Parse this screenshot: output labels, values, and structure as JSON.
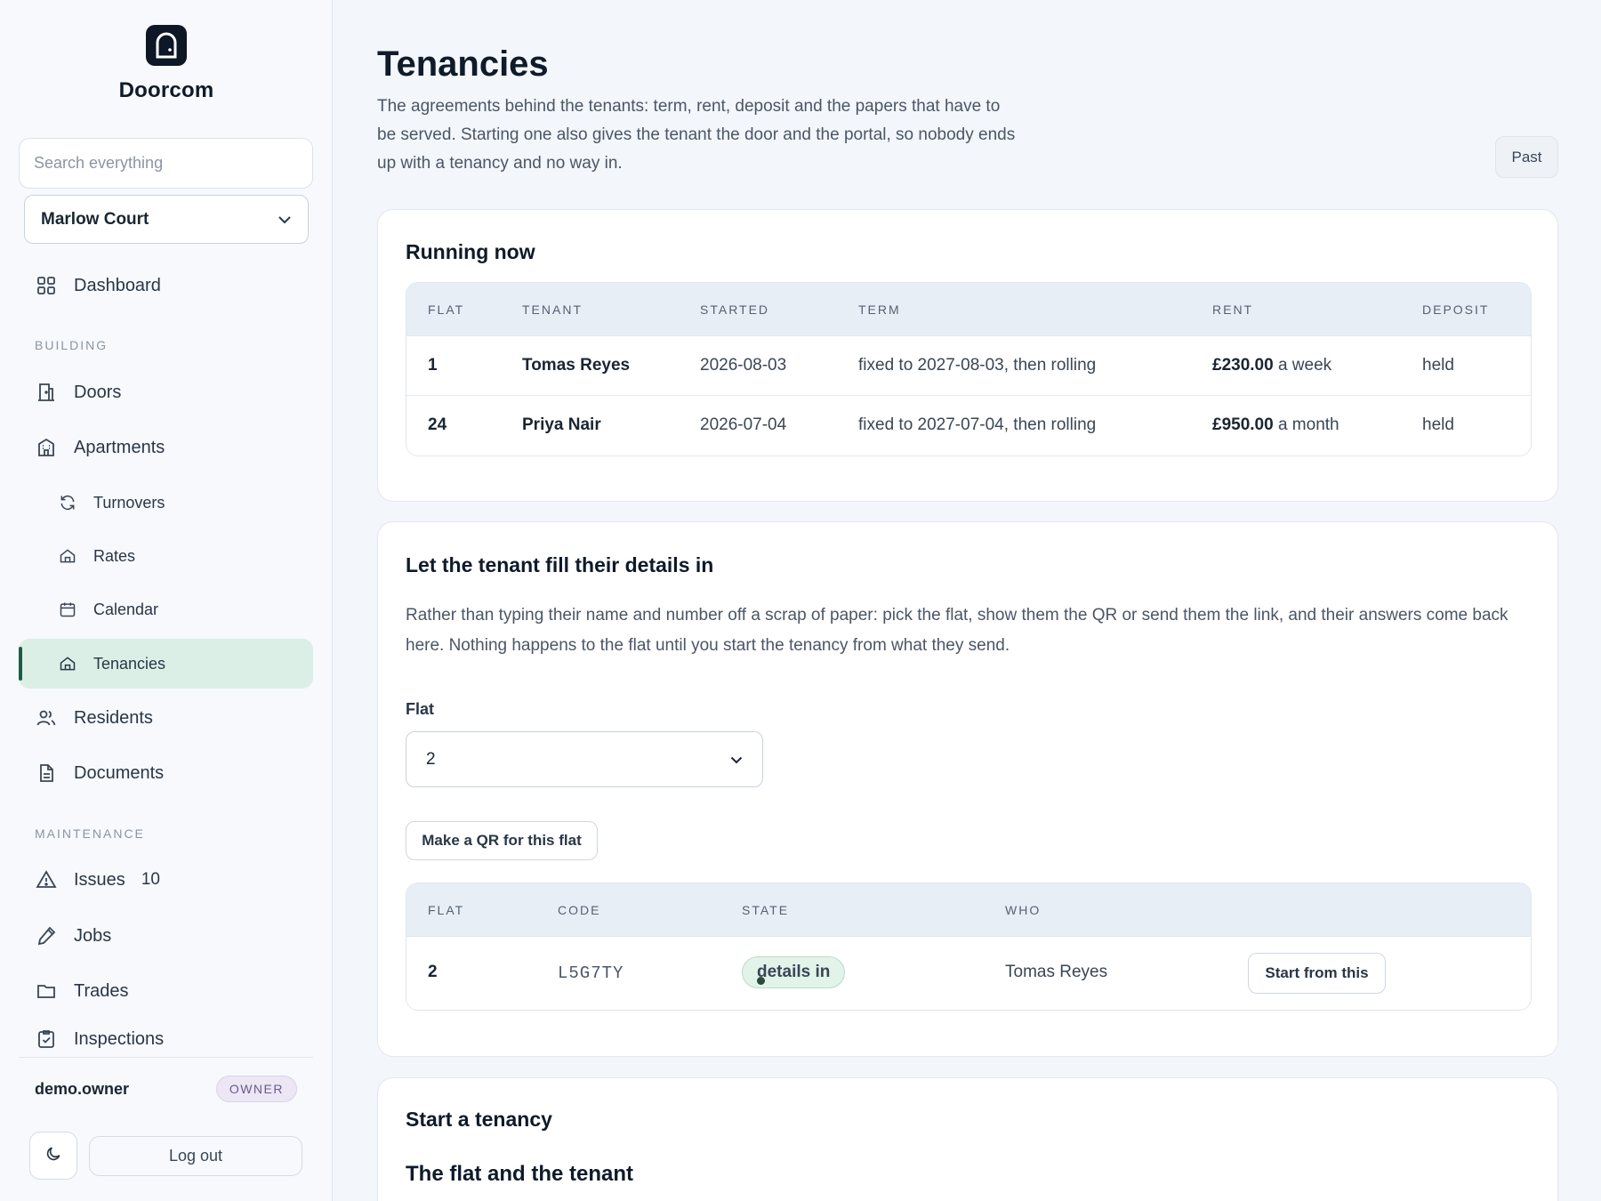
{
  "brand": {
    "name": "Doorcom"
  },
  "sidebar": {
    "search_placeholder": "Search everything",
    "building": "Marlow Court",
    "dashboard": "Dashboard",
    "section_building": "BUILDING",
    "doors": "Doors",
    "apartments": "Apartments",
    "turnovers": "Turnovers",
    "rates": "Rates",
    "calendar": "Calendar",
    "tenancies": "Tenancies",
    "residents": "Residents",
    "documents": "Documents",
    "section_maintenance": "MAINTENANCE",
    "issues": "Issues",
    "issues_count": "10",
    "jobs": "Jobs",
    "trades": "Trades",
    "inspections": "Inspections",
    "user": "demo.owner",
    "role": "OWNER",
    "logout": "Log out"
  },
  "page": {
    "title": "Tenancies",
    "description": "The agreements behind the tenants: term, rent, deposit and the papers that have to be served. Starting one also gives the tenant the door and the portal, so nobody ends up with a tenancy and no way in.",
    "past_button": "Past"
  },
  "running": {
    "title": "Running now",
    "headers": {
      "flat": "FLAT",
      "tenant": "TENANT",
      "started": "STARTED",
      "term": "TERM",
      "rent": "RENT",
      "deposit": "DEPOSIT"
    },
    "rows": [
      {
        "flat": "1",
        "tenant": "Tomas Reyes",
        "started": "2026-08-03",
        "term": "fixed to 2027-08-03, then rolling",
        "rent_amount": "£230.00",
        "rent_period": " a week",
        "deposit": "held"
      },
      {
        "flat": "24",
        "tenant": "Priya Nair",
        "started": "2026-07-04",
        "term": "fixed to 2027-07-04, then rolling",
        "rent_amount": "£950.00",
        "rent_period": " a month",
        "deposit": "held"
      }
    ]
  },
  "fill": {
    "title": "Let the tenant fill their details in",
    "lead": "Rather than typing their name and number off a scrap of paper: pick the flat, show them the QR or send them the link, and their answers come back here. Nothing happens to the flat until you start the tenancy from what they send.",
    "flat_label": "Flat",
    "flat_value": "2",
    "qr_button": "Make a QR for this flat",
    "headers": {
      "flat": "FLAT",
      "code": "CODE",
      "state": "STATE",
      "who": "WHO"
    },
    "rows": [
      {
        "flat": "2",
        "code": "L5G7TY",
        "state": "details in",
        "who": "Tomas Reyes",
        "action": "Start from this"
      }
    ]
  },
  "start": {
    "title": "Start a tenancy",
    "subtitle": "The flat and the tenant"
  }
}
